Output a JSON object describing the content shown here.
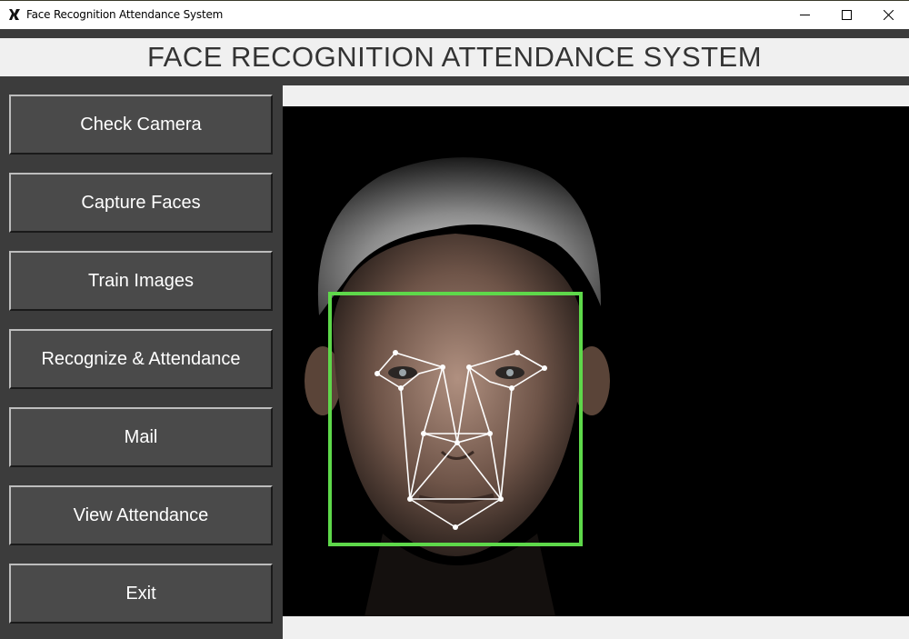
{
  "window": {
    "title": "Face Recognition Attendance System",
    "app_icon": "x-logo-icon",
    "controls": [
      "minimize-icon",
      "maximize-icon",
      "close-icon"
    ]
  },
  "header": {
    "title": "FACE RECOGNITION ATTENDANCE SYSTEM"
  },
  "sidebar": {
    "buttons": [
      {
        "label": "Check Camera"
      },
      {
        "label": "Capture Faces"
      },
      {
        "label": "Train Images"
      },
      {
        "label": "Recognize & Attendance"
      },
      {
        "label": "Mail"
      },
      {
        "label": "View Attendance"
      },
      {
        "label": "Exit"
      }
    ]
  },
  "colors": {
    "frame": "#3c3c3c",
    "button_face": "#4a4a4a",
    "detection_box": "#5ed84a",
    "landmark_lines": "#ffffff"
  }
}
